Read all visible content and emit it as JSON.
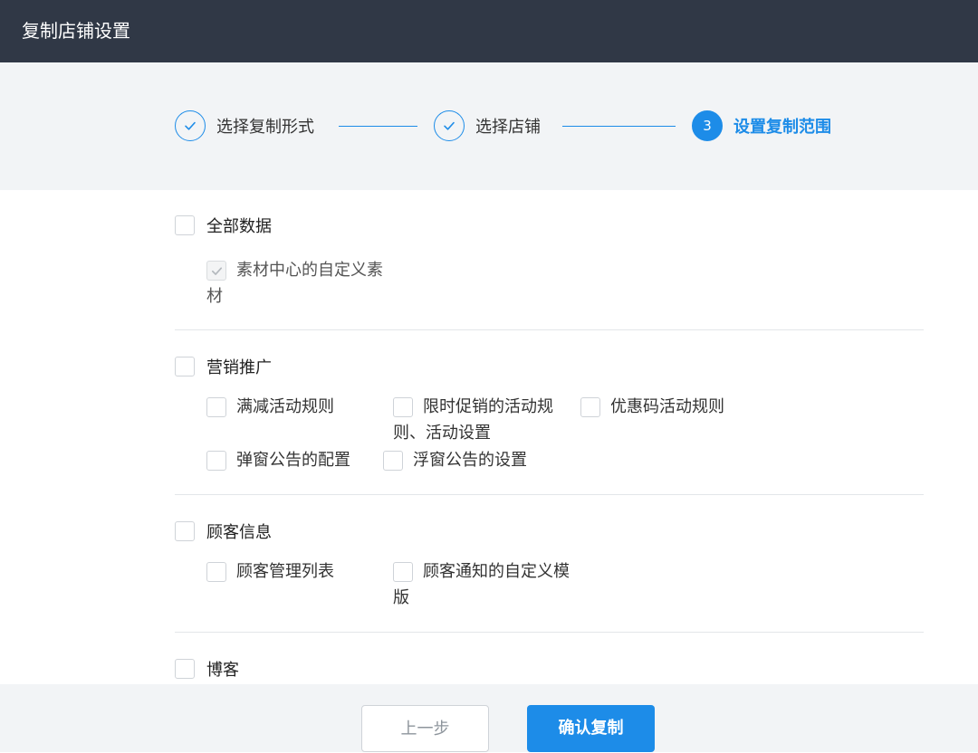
{
  "window": {
    "title": "复制店铺设置"
  },
  "steps": [
    {
      "label": "选择复制形式",
      "status": "done"
    },
    {
      "label": "选择店铺",
      "status": "done"
    },
    {
      "number": "3",
      "label": "设置复制范围",
      "status": "active"
    }
  ],
  "groups": {
    "all": {
      "label": "全部数据",
      "checked": false,
      "options": [
        {
          "label": "素材中心的自定义素材",
          "checked": true,
          "disabled": true
        }
      ]
    },
    "marketing": {
      "label": "营销推广",
      "checked": false,
      "options": [
        {
          "label": "满减活动规则",
          "checked": false
        },
        {
          "label": "限时促销的活动规则、活动设置",
          "checked": false
        },
        {
          "label": "优惠码活动规则",
          "checked": false
        },
        {
          "label": "弹窗公告的配置",
          "checked": false
        },
        {
          "label": "浮窗公告的设置",
          "checked": false
        }
      ]
    },
    "customer": {
      "label": "顾客信息",
      "checked": false,
      "options": [
        {
          "label": "顾客管理列表",
          "checked": false
        },
        {
          "label": "顾客通知的自定义模版",
          "checked": false
        }
      ]
    },
    "blog": {
      "label": "博客",
      "checked": false
    }
  },
  "footer": {
    "prev_label": "上一步",
    "confirm_label": "确认复制"
  },
  "colors": {
    "accent": "#1d8ce8",
    "titlebar": "#303846",
    "panel": "#f2f4f6"
  }
}
